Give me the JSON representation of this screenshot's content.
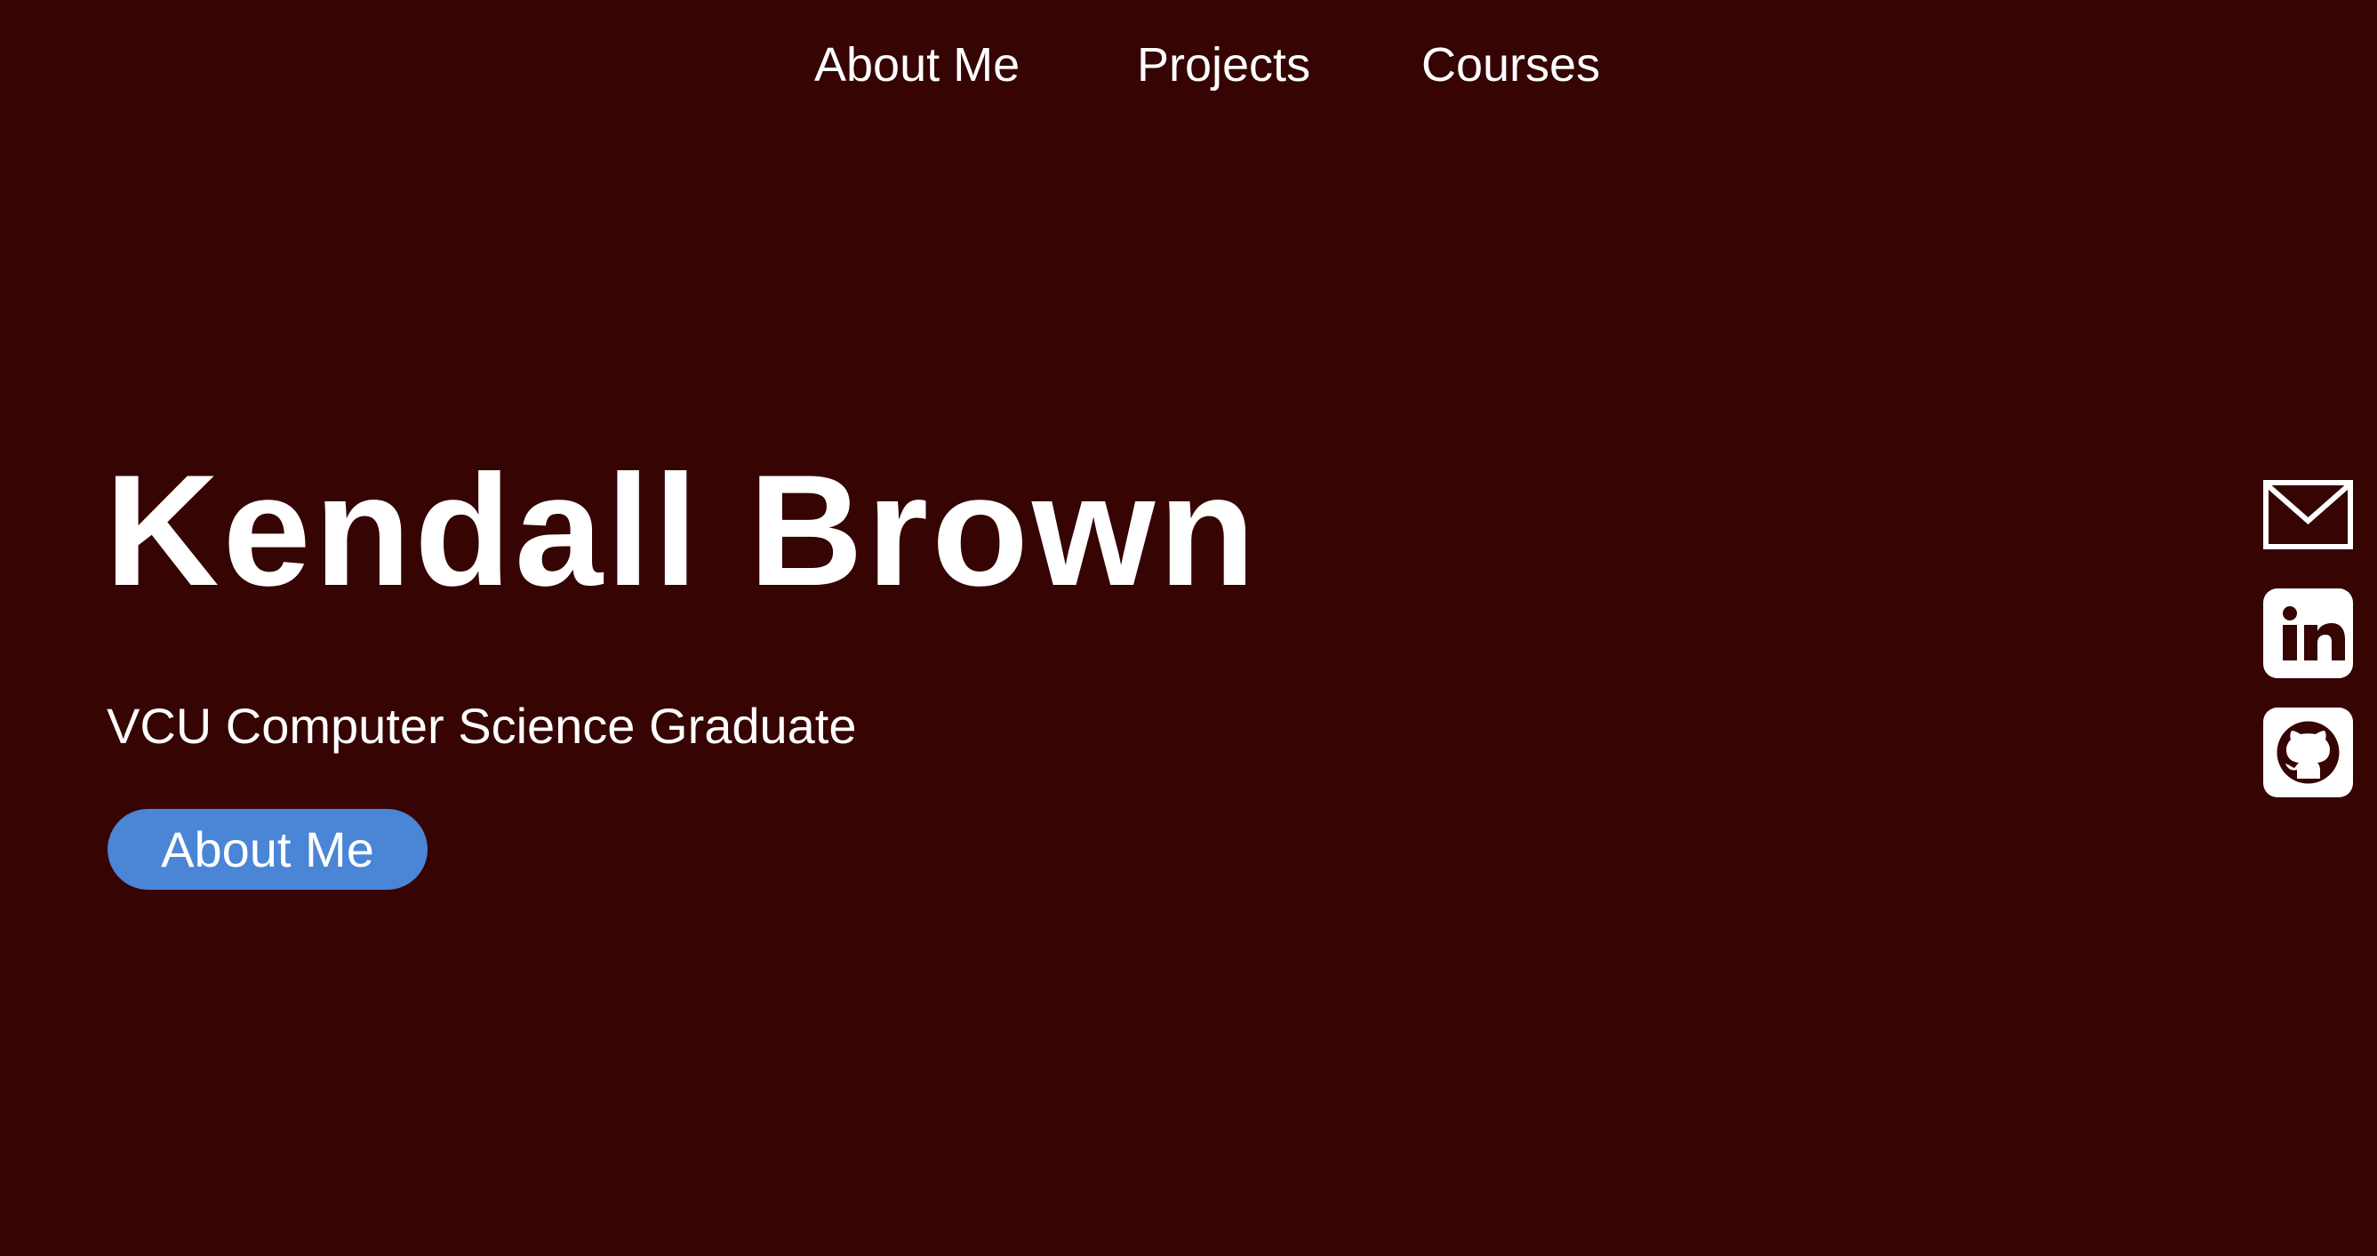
{
  "nav": {
    "items": [
      {
        "label": "About Me"
      },
      {
        "label": "Projects"
      },
      {
        "label": "Courses"
      }
    ]
  },
  "hero": {
    "name": "Kendall Brown",
    "subtitle": "VCU Computer Science Graduate",
    "button_label": "About Me"
  },
  "social": {
    "icons": [
      "email-icon",
      "linkedin-icon",
      "github-icon"
    ]
  },
  "colors": {
    "background": "#350403",
    "text": "#ffffff",
    "button": "#4a85d6"
  }
}
